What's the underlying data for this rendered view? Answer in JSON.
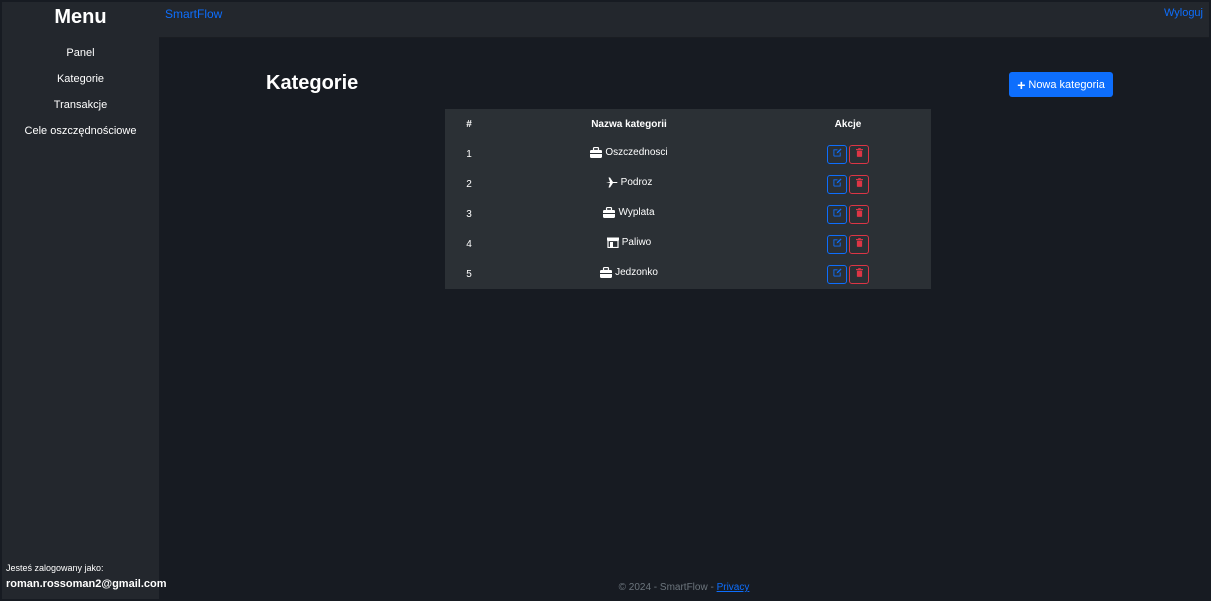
{
  "sidebar": {
    "title": "Menu",
    "items": [
      {
        "label": "Panel"
      },
      {
        "label": "Kategorie"
      },
      {
        "label": "Transakcje"
      },
      {
        "label": "Cele oszczędnościowe"
      }
    ],
    "logged_label": "Jesteś zalogowany jako:",
    "user_email": "roman.rossoman2@gmail.com"
  },
  "header": {
    "brand": "SmartFlow",
    "logout": "Wyloguj"
  },
  "main": {
    "title": "Kategorie",
    "new_button": "Nowa kategoria",
    "table": {
      "headers": [
        "#",
        "Nazwa kategorii",
        "Akcje"
      ],
      "rows": [
        {
          "num": "1",
          "name": "Oszczednosci",
          "icon": "briefcase-icon"
        },
        {
          "num": "2",
          "name": "Podroz",
          "icon": "plane-icon"
        },
        {
          "num": "3",
          "name": "Wyplata",
          "icon": "briefcase-icon"
        },
        {
          "num": "4",
          "name": "Paliwo",
          "icon": "store-icon"
        },
        {
          "num": "5",
          "name": "Jedzonko",
          "icon": "briefcase-icon"
        }
      ]
    }
  },
  "footer": {
    "text": "© 2024 - SmartFlow - ",
    "link": "Privacy"
  },
  "colors": {
    "accent": "#0d6efd",
    "danger": "#dc3545",
    "background": "#171b22",
    "panel": "#23272d",
    "table": "#2b3035"
  }
}
